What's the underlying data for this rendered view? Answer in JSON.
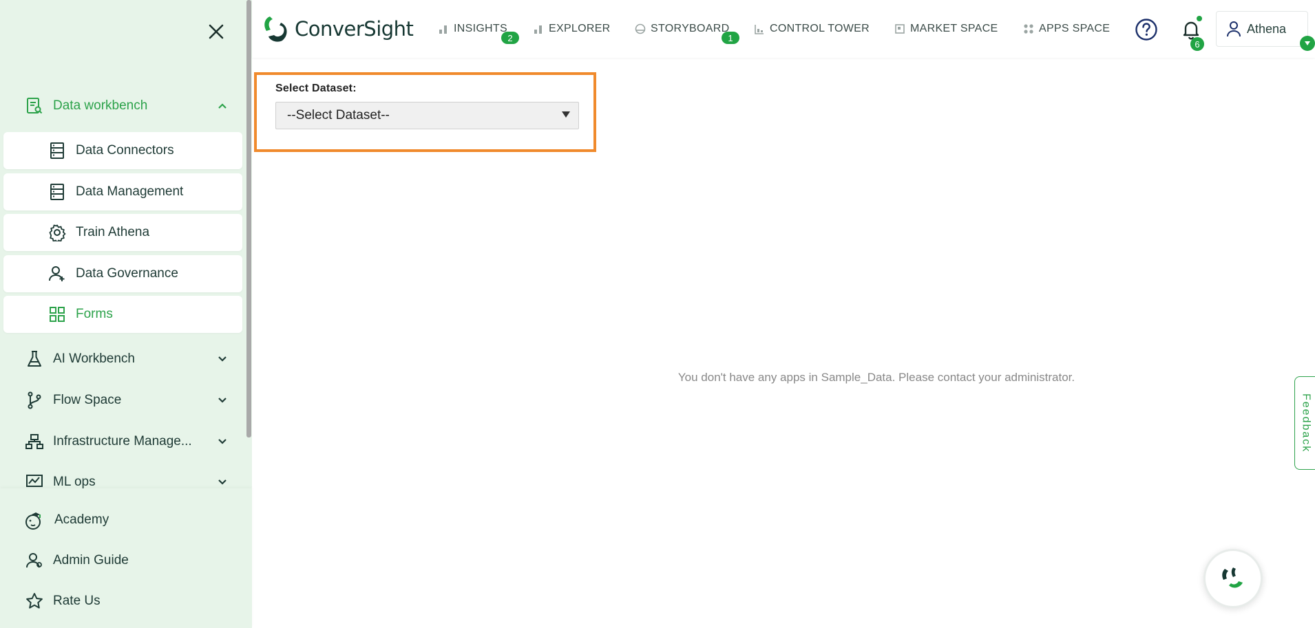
{
  "brand": {
    "name": "ConverSight"
  },
  "sidebar": {
    "sections": [
      {
        "label": "Data workbench",
        "icon": "data-workbench-icon",
        "expanded": true
      },
      {
        "label": "AI Workbench",
        "icon": "flask-icon"
      },
      {
        "label": "Flow Space",
        "icon": "git-branch-icon"
      },
      {
        "label": "Infrastructure Manage...",
        "icon": "sitemap-icon"
      },
      {
        "label": "ML ops",
        "icon": "chart-monitor-icon"
      }
    ],
    "sub_items": [
      {
        "label": "Data Connectors",
        "icon": "server-icon"
      },
      {
        "label": "Data Management",
        "icon": "server-icon"
      },
      {
        "label": "Train Athena",
        "icon": "gear-icon"
      },
      {
        "label": "Data Governance",
        "icon": "user-plus-icon"
      },
      {
        "label": "Forms",
        "icon": "grid-icon",
        "active": true
      }
    ],
    "bottom_items": [
      {
        "label": "Academy",
        "icon": "academy-icon"
      },
      {
        "label": "Admin Guide",
        "icon": "user-guide-icon"
      },
      {
        "label": "Rate Us",
        "icon": "star-icon"
      }
    ]
  },
  "nav": {
    "items": [
      {
        "label": "INSIGHTS",
        "icon": "bar-chart-icon",
        "badge": "2"
      },
      {
        "label": "EXPLORER",
        "icon": "bar-chart-icon"
      },
      {
        "label": "STORYBOARD",
        "icon": "storyboard-icon",
        "badge": "1"
      },
      {
        "label": "CONTROL TOWER",
        "icon": "tower-icon"
      },
      {
        "label": "MARKET SPACE",
        "icon": "market-icon"
      },
      {
        "label": "APPS SPACE",
        "icon": "apps-icon"
      }
    ],
    "notifications_badge": "6",
    "user_name": "Athena"
  },
  "main": {
    "dataset_label": "Select Dataset:",
    "dataset_value": "--Select Dataset--",
    "empty_message": "You don't have any apps in Sample_Data. Please contact your administrator."
  },
  "feedback_label": "Feedback",
  "colors": {
    "accent": "#2ca24a",
    "highlight": "#f08a2c",
    "sidebar_bg": "#e7f4e9"
  }
}
